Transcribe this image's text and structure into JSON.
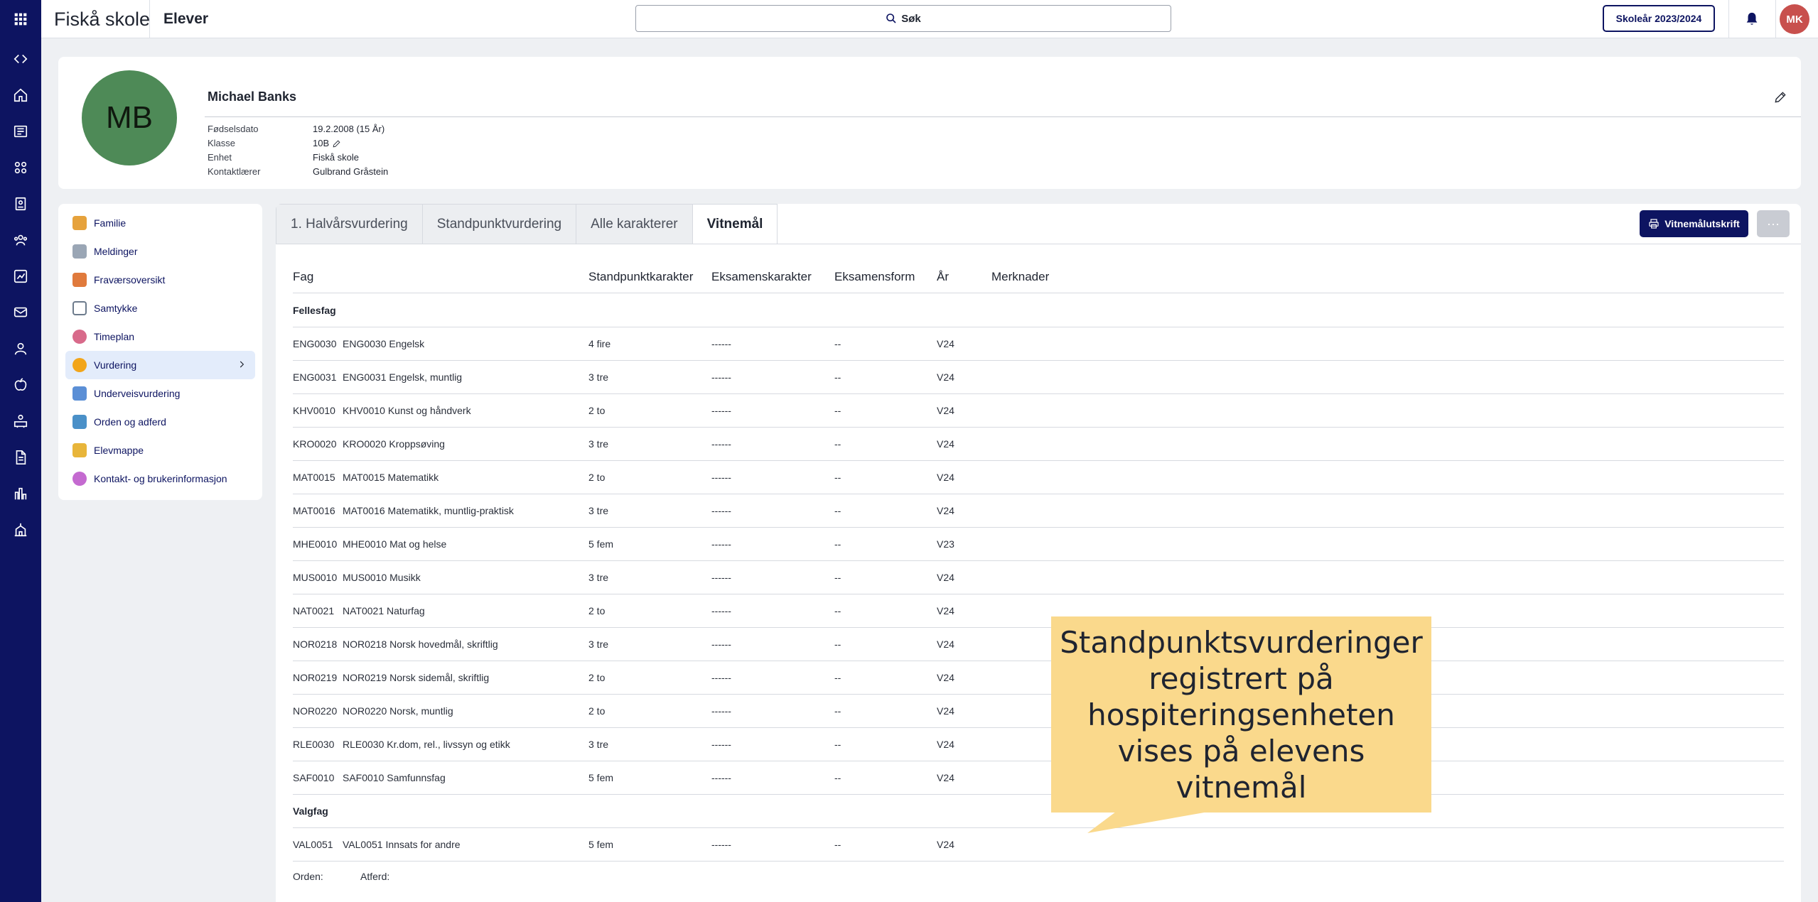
{
  "app": {
    "school": "Fiskå skole",
    "section": "Elever",
    "search_label": "Søk",
    "school_year": "Skoleår 2023/2024",
    "user_initials": "MK"
  },
  "student": {
    "initials": "MB",
    "name": "Michael Banks",
    "fields": [
      {
        "label": "Fødselsdato",
        "value": "19.2.2008 (15 År)"
      },
      {
        "label": "Klasse",
        "value": "10B"
      },
      {
        "label": "Enhet",
        "value": "Fiskå skole"
      },
      {
        "label": "Kontaktlærer",
        "value": "Gulbrand Gråstein"
      }
    ]
  },
  "menu": [
    {
      "label": "Familie",
      "color": "#e6a23c"
    },
    {
      "label": "Meldinger",
      "color": "#9aa6b5"
    },
    {
      "label": "Fraværsoversikt",
      "color": "#e07a3c"
    },
    {
      "label": "Samtykke",
      "color": "#6d7b8c"
    },
    {
      "label": "Timeplan",
      "color": "#d86a8a"
    },
    {
      "label": "Vurdering",
      "color": "#f2a51a"
    },
    {
      "label": "Underveisvurdering",
      "color": "#5b8fd6"
    },
    {
      "label": "Orden og adferd",
      "color": "#4a90c8"
    },
    {
      "label": "Elevmappe",
      "color": "#e8b53a"
    },
    {
      "label": "Kontakt- og brukerinformasjon",
      "color": "#c46ad0"
    }
  ],
  "tabs": [
    "1. Halvårsvurdering",
    "Standpunktvurdering",
    "Alle karakterer",
    "Vitnemål"
  ],
  "buttons": {
    "print": "Vitnemålutskrift",
    "more": "···"
  },
  "table": {
    "headers": [
      "Fag",
      "Standpunktkarakter",
      "Eksamenskarakter",
      "Eksamensform",
      "År",
      "Merknader"
    ],
    "groups": [
      {
        "name": "Fellesfag",
        "rows": [
          {
            "code": "ENG0030",
            "subject": "ENG0030 Engelsk",
            "grade": "4 fire",
            "exam": "------",
            "form": "--",
            "year": "V24"
          },
          {
            "code": "ENG0031",
            "subject": "ENG0031 Engelsk, muntlig",
            "grade": "3 tre",
            "exam": "------",
            "form": "--",
            "year": "V24"
          },
          {
            "code": "KHV0010",
            "subject": "KHV0010 Kunst og håndverk",
            "grade": "2 to",
            "exam": "------",
            "form": "--",
            "year": "V24"
          },
          {
            "code": "KRO0020",
            "subject": "KRO0020 Kroppsøving",
            "grade": "3 tre",
            "exam": "------",
            "form": "--",
            "year": "V24"
          },
          {
            "code": "MAT0015",
            "subject": "MAT0015 Matematikk",
            "grade": "2 to",
            "exam": "------",
            "form": "--",
            "year": "V24"
          },
          {
            "code": "MAT0016",
            "subject": "MAT0016 Matematikk, muntlig-praktisk",
            "grade": "3 tre",
            "exam": "------",
            "form": "--",
            "year": "V24"
          },
          {
            "code": "MHE0010",
            "subject": "MHE0010 Mat og helse",
            "grade": "5 fem",
            "exam": "------",
            "form": "--",
            "year": "V23"
          },
          {
            "code": "MUS0010",
            "subject": "MUS0010 Musikk",
            "grade": "3 tre",
            "exam": "------",
            "form": "--",
            "year": "V24"
          },
          {
            "code": "NAT0021",
            "subject": "NAT0021 Naturfag",
            "grade": "2 to",
            "exam": "------",
            "form": "--",
            "year": "V24"
          },
          {
            "code": "NOR0218",
            "subject": "NOR0218 Norsk hovedmål, skriftlig",
            "grade": "3 tre",
            "exam": "------",
            "form": "--",
            "year": "V24"
          },
          {
            "code": "NOR0219",
            "subject": "NOR0219 Norsk sidemål, skriftlig",
            "grade": "2 to",
            "exam": "------",
            "form": "--",
            "year": "V24"
          },
          {
            "code": "NOR0220",
            "subject": "NOR0220 Norsk, muntlig",
            "grade": "2 to",
            "exam": "------",
            "form": "--",
            "year": "V24"
          },
          {
            "code": "RLE0030",
            "subject": "RLE0030 Kr.dom, rel., livssyn og etikk",
            "grade": "3 tre",
            "exam": "------",
            "form": "--",
            "year": "V24"
          },
          {
            "code": "SAF0010",
            "subject": "SAF0010 Samfunnsfag",
            "grade": "5 fem",
            "exam": "------",
            "form": "--",
            "year": "V24"
          }
        ]
      },
      {
        "name": "Valgfag",
        "rows": [
          {
            "code": "VAL0051",
            "subject": "VAL0051 Innsats for andre",
            "grade": "5 fem",
            "exam": "------",
            "form": "--",
            "year": "V24"
          }
        ]
      }
    ],
    "footer": {
      "orden": "Orden:",
      "atferd": "Atferd:"
    }
  },
  "callout": {
    "lines": [
      "Standpunktsvurderinger",
      "registrert på",
      "hospiteringsenheten",
      "vises på elevens",
      "vitnemål"
    ]
  }
}
